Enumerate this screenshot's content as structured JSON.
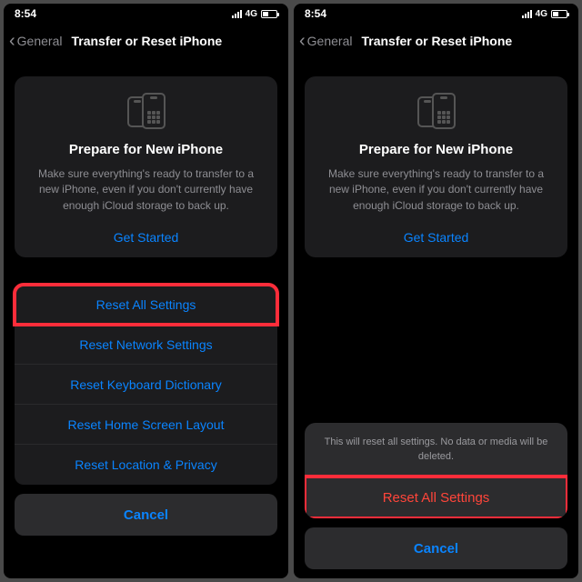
{
  "status": {
    "time": "8:54 ؜",
    "net": "4G"
  },
  "nav": {
    "back": "General",
    "title": "Transfer or Reset iPhone"
  },
  "card": {
    "title": "Prepare for New iPhone",
    "desc": "Make sure everything's ready to transfer to a new iPhone, even if you don't currently have enough iCloud storage to back up.",
    "cta": "Get Started"
  },
  "reset_options": [
    "Reset All Settings",
    "Reset Network Settings",
    "Reset Keyboard Dictionary",
    "Reset Home Screen Layout",
    "Reset Location & Privacy"
  ],
  "cancel": "Cancel",
  "confirm": {
    "message": "This will reset all settings. No data or media will be deleted.",
    "action": "Reset All Settings"
  }
}
